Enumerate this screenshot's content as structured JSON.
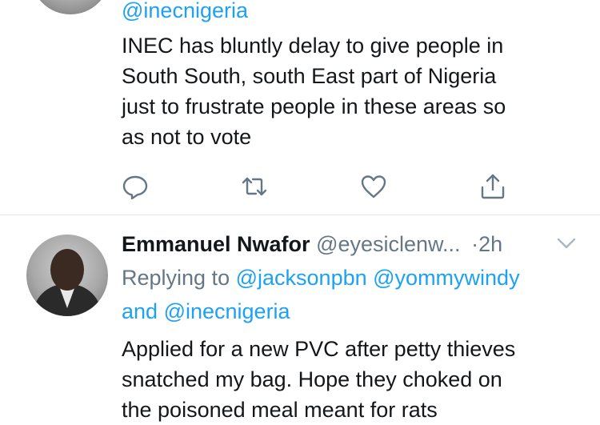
{
  "tweet1": {
    "handle_line": "@inecnigeria",
    "text": [
      "INEC has bluntly delay to give people in",
      "South South, south East part of Nigeria",
      "just to frustrate people in these areas so",
      "as not to vote"
    ],
    "actions": [
      "reply-icon",
      "retweet-icon",
      "like-icon",
      "share-icon"
    ]
  },
  "tweet2": {
    "name": "Emmanuel Nwafor",
    "handle": "@eyesiclenw...",
    "dot": "·",
    "time": "2h",
    "replying_label": "Replying to",
    "reply_handle_1": "@jacksonpbn",
    "reply_handle_2": "@yommywindy",
    "and_label": "and",
    "reply_handle_3": "@inecnigeria",
    "text": [
      "Applied for a new PVC after petty thieves",
      "snatched my bag. Hope they choked on",
      "the poisoned meal meant for rats"
    ]
  },
  "colors": {
    "accent": "#1da1f2",
    "gray": "#657786",
    "text": "#14171a",
    "divider": "#e1e8ed"
  }
}
